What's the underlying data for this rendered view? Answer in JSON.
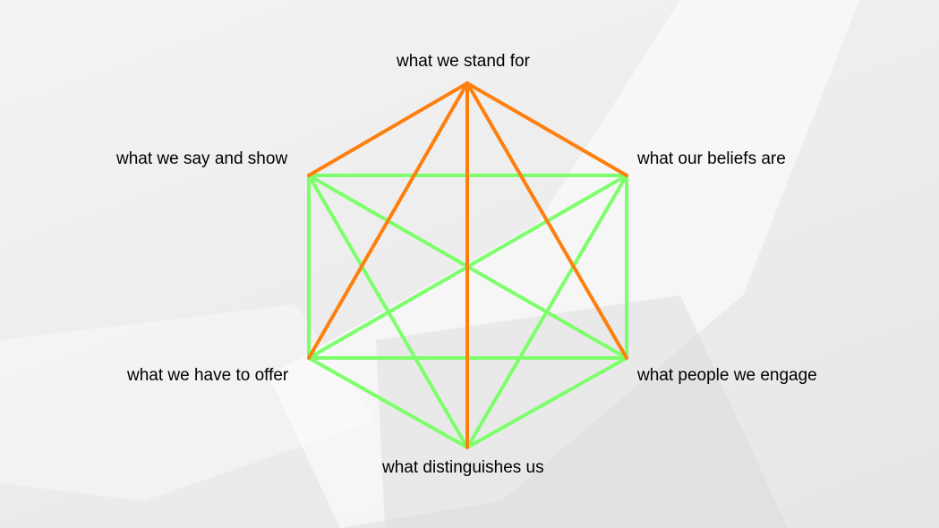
{
  "colors": {
    "background": "#efefef",
    "outer_frame_lines": "#7dff6b",
    "pyramid_lines": "#ff7f0e",
    "label_text": "#000000"
  },
  "nodes": {
    "top": "what we stand for",
    "upper_left": "what we say and show",
    "upper_right": "what our beliefs are",
    "lower_left": "what we have to offer",
    "lower_right": "what people we engage",
    "bottom": "what distinguishes us"
  },
  "connections": {
    "green": [
      [
        "upper_left",
        "upper_right"
      ],
      [
        "upper_left",
        "lower_left"
      ],
      [
        "upper_right",
        "lower_right"
      ],
      [
        "lower_left",
        "lower_right"
      ],
      [
        "upper_left",
        "lower_right"
      ],
      [
        "upper_right",
        "lower_left"
      ],
      [
        "upper_left",
        "bottom"
      ],
      [
        "upper_right",
        "bottom"
      ],
      [
        "lower_left",
        "bottom"
      ],
      [
        "lower_right",
        "bottom"
      ]
    ],
    "orange": [
      [
        "top",
        "upper_left"
      ],
      [
        "top",
        "upper_right"
      ],
      [
        "top",
        "lower_left"
      ],
      [
        "top",
        "lower_right"
      ],
      [
        "top",
        "bottom"
      ]
    ]
  }
}
